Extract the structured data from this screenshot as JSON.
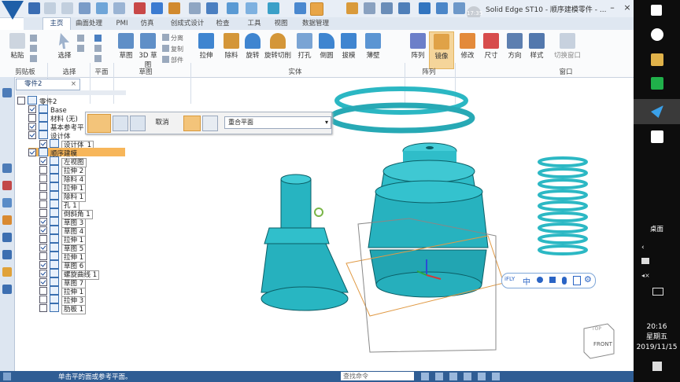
{
  "window": {
    "title": "Solid Edge ST10 - 顺序建模零件 - ...",
    "time_badge": "17:35"
  },
  "tabs": [
    "主页",
    "曲面处理",
    "PMI",
    "仿真",
    "创成式设计",
    "检查",
    "工具",
    "视图",
    "数据管理"
  ],
  "ribbon": {
    "clipboard": {
      "paste": "粘贴",
      "group": "剪贴板"
    },
    "select": {
      "label": "选择",
      "group": "选择"
    },
    "plane": {
      "group": "平面"
    },
    "sketch": {
      "sketch": "草图",
      "sketch3d": "3D\n草图",
      "group": "草图",
      "small": [
        "分离",
        "复制",
        "部件"
      ]
    },
    "solid": {
      "buttons": [
        "拉伸",
        "除料",
        "旋转",
        "旋转切削",
        "打孔",
        "倒圆",
        "拔模",
        "薄壁"
      ],
      "group": "实体"
    },
    "array": {
      "buttons": [
        "阵列",
        "镜像"
      ],
      "group": "阵列"
    },
    "other": {
      "buttons": [
        "修改",
        "尺寸",
        "方向",
        "样式",
        "切换窗口"
      ],
      "group": "窗口"
    }
  },
  "panel": {
    "tab": "零件2"
  },
  "tree": [
    {
      "label": "零件2",
      "level": 0,
      "check": false
    },
    {
      "label": "Base",
      "level": 1,
      "check": true
    },
    {
      "label": "材料 (无)",
      "level": 1,
      "check": false
    },
    {
      "label": "基本参考平",
      "level": 1,
      "check": true
    },
    {
      "label": "设计体",
      "level": 1,
      "check": true
    },
    {
      "label": "设计体_1",
      "level": 2,
      "check": true
    },
    {
      "label": "顺序建模",
      "level": 1,
      "check": true,
      "highlight": true
    },
    {
      "label": "左视图",
      "level": 2,
      "check": true
    },
    {
      "label": "拉伸 2",
      "level": 2,
      "check": false
    },
    {
      "label": "除料 4",
      "level": 2,
      "check": false
    },
    {
      "label": "拉伸 1",
      "level": 2,
      "check": false
    },
    {
      "label": "除料 1",
      "level": 2,
      "check": false
    },
    {
      "label": "孔 1",
      "level": 2,
      "check": false
    },
    {
      "label": "倒斜角 1",
      "level": 2,
      "check": false
    },
    {
      "label": "草图 3",
      "level": 2,
      "check": true
    },
    {
      "label": "草图 4",
      "level": 2,
      "check": true
    },
    {
      "label": "拉伸 1",
      "level": 2,
      "check": false
    },
    {
      "label": "草图 5",
      "level": 2,
      "check": true
    },
    {
      "label": "拉伸 1",
      "level": 2,
      "check": false
    },
    {
      "label": "草图 6",
      "level": 2,
      "check": true
    },
    {
      "label": "螺旋曲线 1",
      "level": 2,
      "check": true
    },
    {
      "label": "草图 7",
      "level": 2,
      "check": true
    },
    {
      "label": "拉伸 1",
      "level": 2,
      "check": false
    },
    {
      "label": "拉伸 3",
      "level": 2,
      "check": false
    },
    {
      "label": "肋板 1",
      "level": 2,
      "check": false
    }
  ],
  "commandbar": {
    "cancel": "取消",
    "plane_select": "重合平面"
  },
  "statusbar": {
    "message": "单击平的面或参考平面。",
    "search_placeholder": "查找命令"
  },
  "viewcube": {
    "front": "FRONT",
    "top": "TOP"
  },
  "ime": {
    "brand": "iFLY",
    "mode": "中"
  },
  "taskbar": {
    "desktop": "桌面",
    "time": "20:16",
    "weekday": "星期五",
    "date": "2019/11/15"
  },
  "colors": {
    "model": "#29b8c4",
    "accent": "#2f5d94",
    "highlight": "#f7b65a"
  }
}
